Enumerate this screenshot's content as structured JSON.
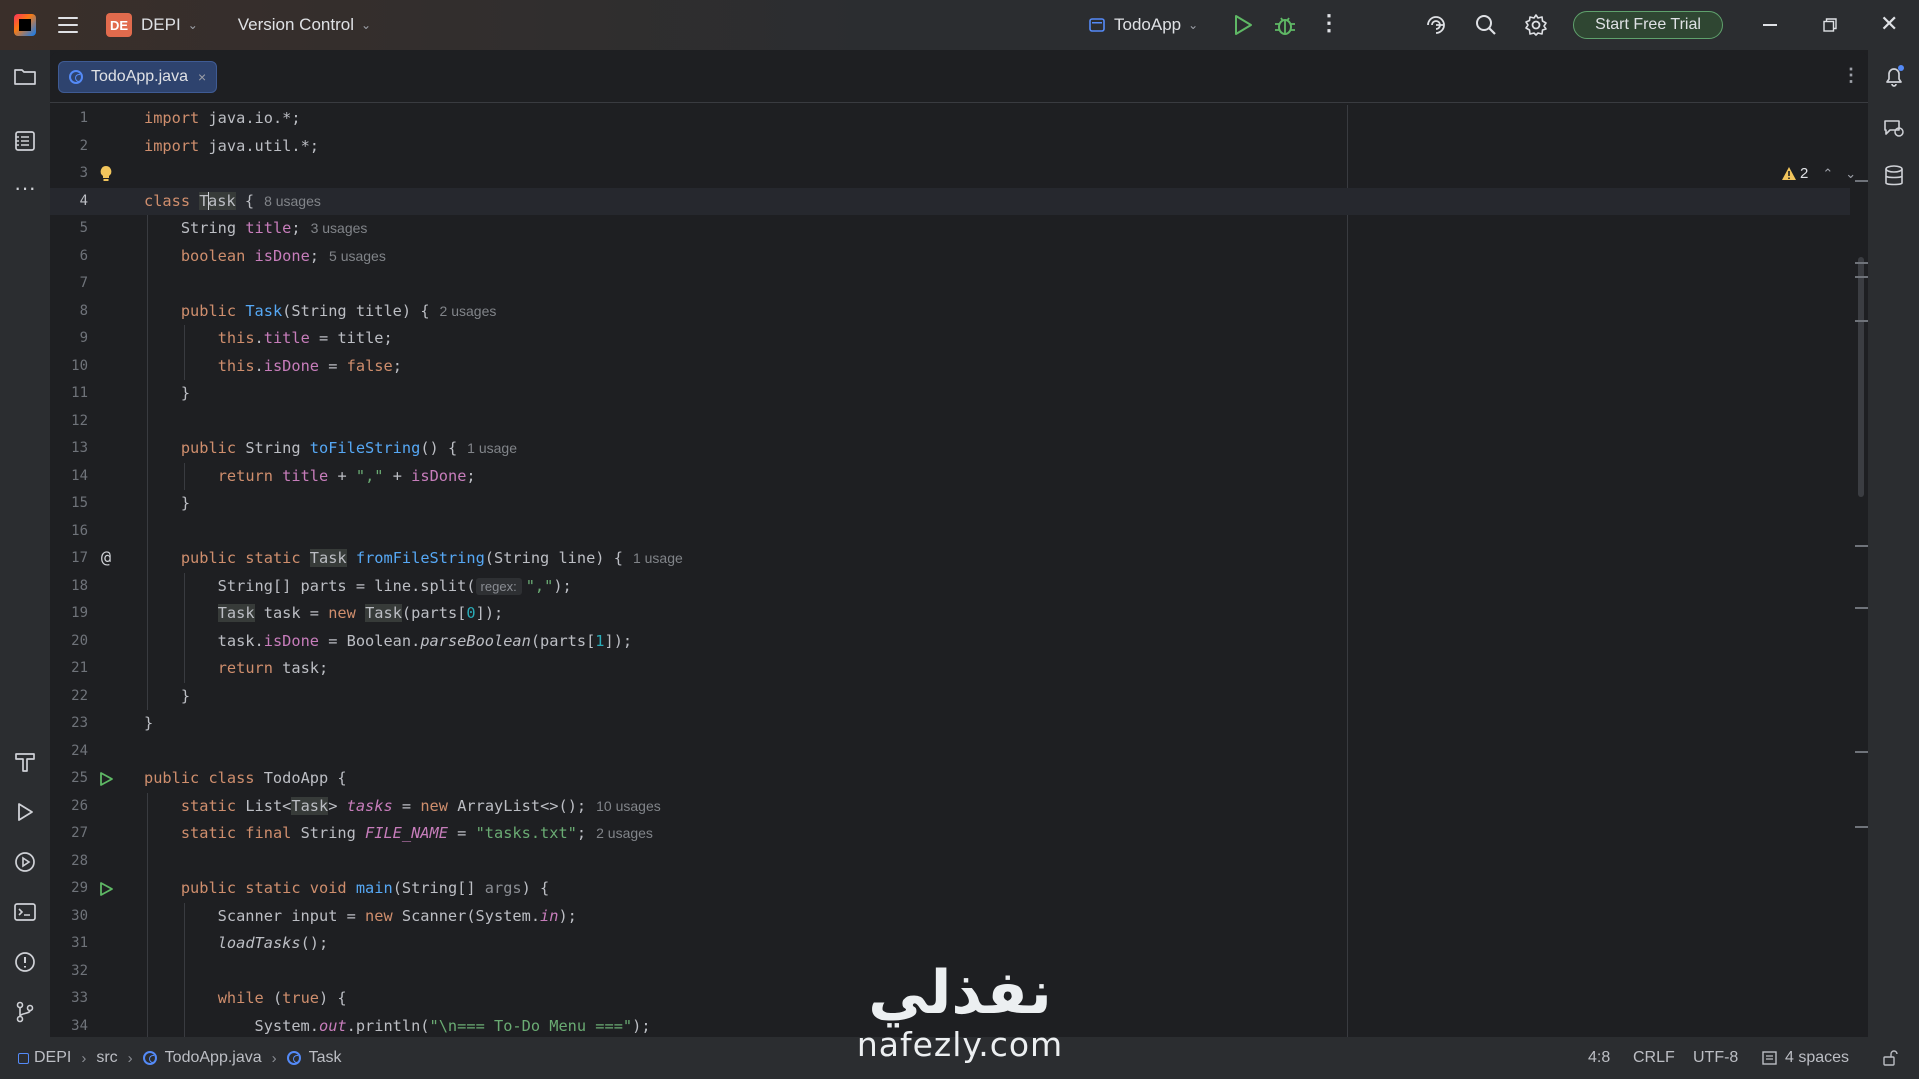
{
  "titlebar": {
    "project_badge": "DE",
    "project_name": "DEPI",
    "vcs_label": "Version Control",
    "run_config": "TodoApp",
    "trial_button": "Start Free Trial"
  },
  "tabs": [
    {
      "label": "TodoApp.java",
      "close": "×"
    }
  ],
  "editor": {
    "warnings_count": "2",
    "lines": [
      {
        "n": "1",
        "html": "<span class=\"kw\">import</span> java.io.*;"
      },
      {
        "n": "2",
        "html": "<span class=\"kw\">import</span> java.util.*;"
      },
      {
        "n": "3",
        "html": ""
      },
      {
        "n": "4",
        "html": "<span class=\"kw\">class</span> <span class=\"hl\">T<span class=\"caret\"></span>ask</span> {<span class=\"hint\">8 usages</span>"
      },
      {
        "n": "5",
        "html": "    String <span class=\"fld\">title</span>;<span class=\"hint\">3 usages</span>"
      },
      {
        "n": "6",
        "html": "    <span class=\"kw\">boolean</span> <span class=\"fld\">isDone</span>;<span class=\"hint\">5 usages</span>"
      },
      {
        "n": "7",
        "html": ""
      },
      {
        "n": "8",
        "html": "    <span class=\"kw\">public</span> <span class=\"fn\">Task</span>(String title) {<span class=\"hint\">2 usages</span>"
      },
      {
        "n": "9",
        "html": "        <span class=\"kw\">this</span>.<span class=\"fld\">title</span> = title;"
      },
      {
        "n": "10",
        "html": "        <span class=\"kw\">this</span>.<span class=\"fld\">isDone</span> = <span class=\"kw\">false</span>;"
      },
      {
        "n": "11",
        "html": "    }"
      },
      {
        "n": "12",
        "html": ""
      },
      {
        "n": "13",
        "html": "    <span class=\"kw\">public</span> String <span class=\"fn\">toFileString</span>() {<span class=\"hint\">1 usage</span>"
      },
      {
        "n": "14",
        "html": "        <span class=\"kw\">return</span> <span class=\"fld\">title</span> + <span class=\"str\">\",\"</span> + <span class=\"fld\">isDone</span>;"
      },
      {
        "n": "15",
        "html": "    }"
      },
      {
        "n": "16",
        "html": ""
      },
      {
        "n": "17",
        "html": "    <span class=\"kw\">public static</span> <span class=\"hl\">Task</span> <span class=\"fn\">fromFileString</span>(String line) {<span class=\"hint\">1 usage</span>"
      },
      {
        "n": "18",
        "html": "        String[] parts = line.split(<span class=\"inlay\">regex:</span><span class=\"str\">\",\"</span>);"
      },
      {
        "n": "19",
        "html": "        <span class=\"hl\">Task</span> task = <span class=\"kw\">new</span> <span class=\"hl\">Task</span>(parts[<span class=\"num\">0</span>]);"
      },
      {
        "n": "20",
        "html": "        task.<span class=\"fld\">isDone</span> = Boolean.<span class=\"itfn\">parseBoolean</span>(parts[<span class=\"num\">1</span>]);"
      },
      {
        "n": "21",
        "html": "        <span class=\"kw\">return</span> task;"
      },
      {
        "n": "22",
        "html": "    }"
      },
      {
        "n": "23",
        "html": "}"
      },
      {
        "n": "24",
        "html": ""
      },
      {
        "n": "25",
        "html": "<span class=\"kw\">public class</span> TodoApp {"
      },
      {
        "n": "26",
        "html": "    <span class=\"kw\">static</span> List&lt;<span class=\"hl\">Task</span>&gt; <span class=\"fld it\">tasks</span> = <span class=\"kw\">new</span> ArrayList&lt;&gt;();<span class=\"hint\">10 usages</span>"
      },
      {
        "n": "27",
        "html": "    <span class=\"kw\">static final</span> String <span class=\"fld it\">FILE_NAME</span> = <span class=\"str\">\"tasks.txt\"</span>;<span class=\"hint\">2 usages</span>"
      },
      {
        "n": "28",
        "html": ""
      },
      {
        "n": "29",
        "html": "    <span class=\"kw\">public static void</span> <span class=\"fn\">main</span>(String[] <span class=\"param\">args</span>) {"
      },
      {
        "n": "30",
        "html": "        Scanner input = <span class=\"kw\">new</span> Scanner(System.<span class=\"fld it\">in</span>);"
      },
      {
        "n": "31",
        "html": "        <span class=\"itfn\">loadTasks</span>();"
      },
      {
        "n": "32",
        "html": ""
      },
      {
        "n": "33",
        "html": "        <span class=\"kw\">while</span> (<span class=\"kw\">true</span>) {"
      },
      {
        "n": "34",
        "html": "            System.<span class=\"fld it\">out</span>.println(<span class=\"str\">\"\\n=== To-Do Menu ===\"</span>);"
      }
    ]
  },
  "statusbar": {
    "breadcrumbs": [
      "DEPI",
      "src",
      "TodoApp.java",
      "Task"
    ],
    "position": "4:8",
    "line_sep": "CRLF",
    "encoding": "UTF-8",
    "indent": "4 spaces"
  },
  "watermark": {
    "arabic": "نفذلي",
    "latin": "nafezly.com"
  },
  "colors": {
    "keyword": "#cf8e6d",
    "function": "#56a8f5",
    "field": "#c77dbb",
    "string": "#6aab73",
    "number": "#2aacb8",
    "accent": "#548af7",
    "trial_border": "#5fa16c",
    "run": "#5fb865"
  }
}
